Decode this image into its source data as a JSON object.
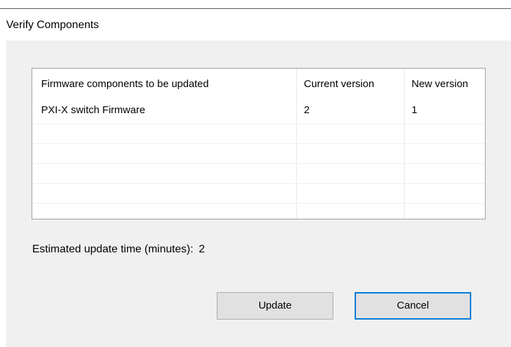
{
  "window": {
    "title": "Verify Components"
  },
  "table": {
    "columns": [
      "Firmware components to be updated",
      "Current version",
      "New version"
    ],
    "rows": [
      [
        "PXI-X switch Firmware",
        "2",
        "1"
      ]
    ],
    "empty_row_count": 5
  },
  "estimate": {
    "label": "Estimated update time (minutes):",
    "value": "2"
  },
  "buttons": {
    "update_label": "Update",
    "cancel_label": "Cancel"
  },
  "colors": {
    "client_background": "#f0f0f0",
    "default_button_border": "#0078d7"
  }
}
